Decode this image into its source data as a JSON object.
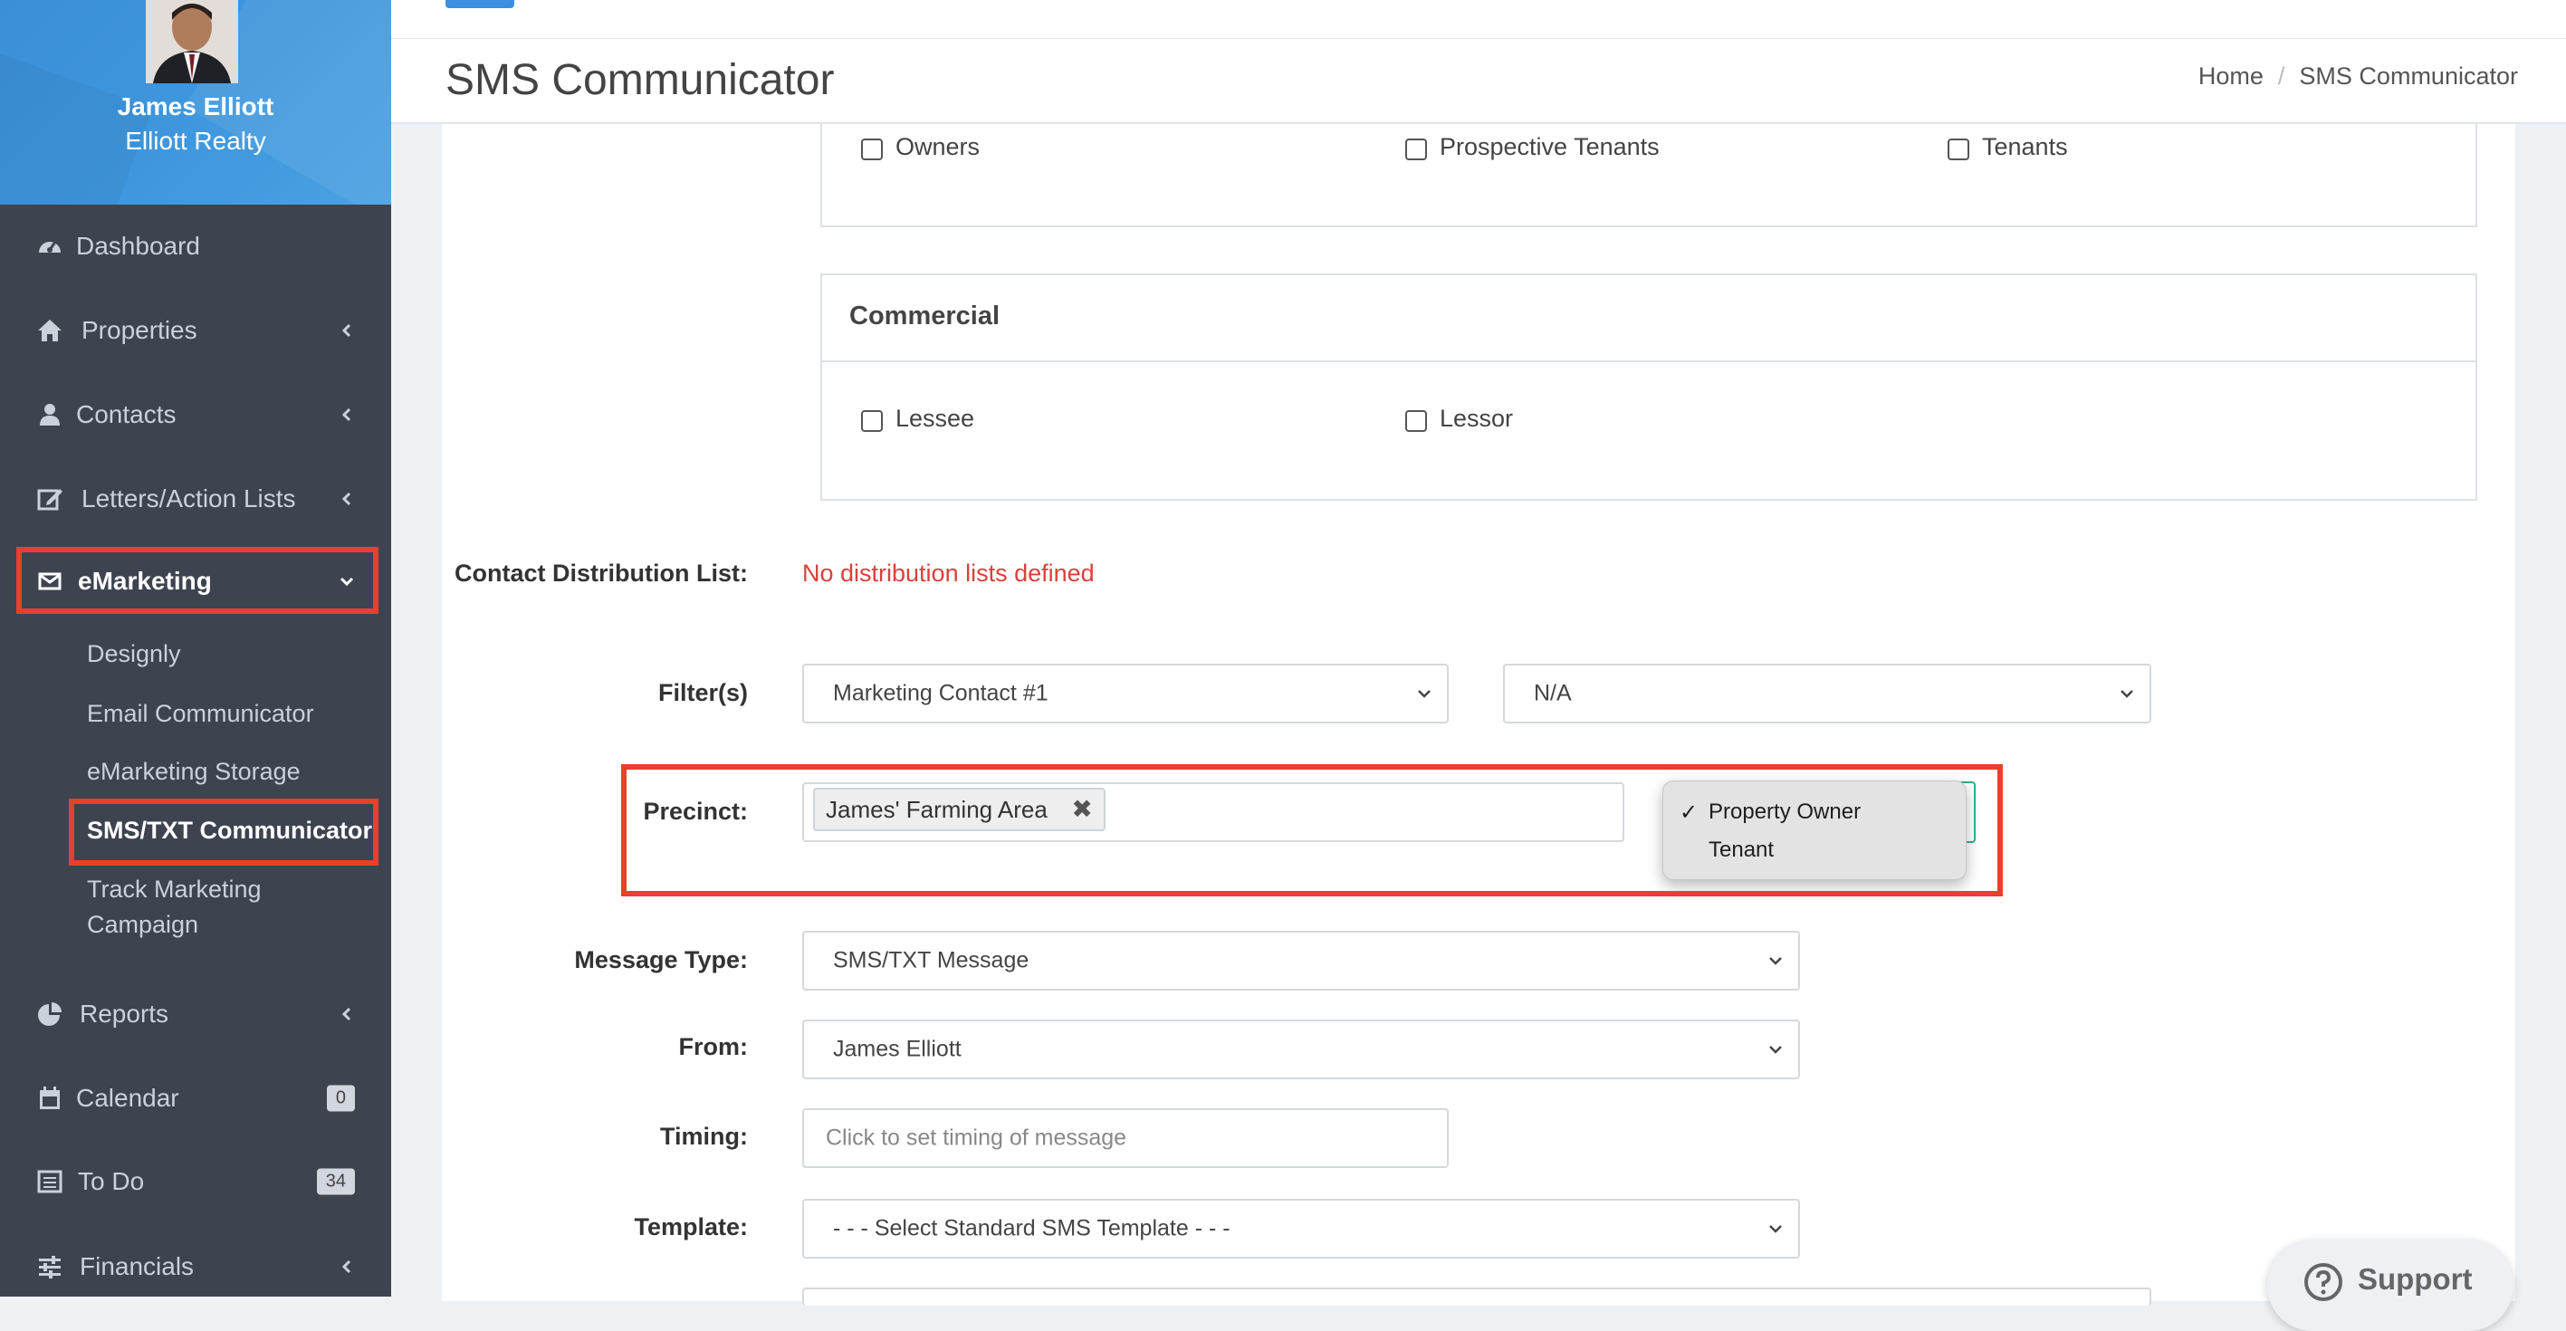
{
  "profile": {
    "name": "James Elliott",
    "company": "Elliott Realty"
  },
  "nav": {
    "dashboard": "Dashboard",
    "properties": "Properties",
    "contacts": "Contacts",
    "letters": "Letters/Action Lists",
    "emarketing": "eMarketing",
    "sub": {
      "designly": "Designly",
      "email": "Email Communicator",
      "storage": "eMarketing Storage",
      "sms": "SMS/TXT Communicator",
      "track_line1": "Track Marketing",
      "track_line2": "Campaign"
    },
    "reports": "Reports",
    "calendar": "Calendar",
    "calendar_badge": "0",
    "todo": "To Do",
    "todo_badge": "34",
    "financials": "Financials"
  },
  "header": {
    "title": "SMS Communicator"
  },
  "breadcrumb": {
    "home": "Home",
    "separator": "/",
    "current": "SMS Communicator"
  },
  "residential": {
    "owners": "Owners",
    "prospective": "Prospective Tenants",
    "tenants": "Tenants"
  },
  "commercial": {
    "heading": "Commercial",
    "lessee": "Lessee",
    "lessor": "Lessor"
  },
  "form": {
    "dist_label": "Contact Distribution List:",
    "dist_value": "No distribution lists defined",
    "filters_label": "Filter(s)",
    "filter1": "Marketing Contact #1",
    "filter2": "N/A",
    "precinct_label": "Precinct:",
    "precinct_tag": "James' Farming Area",
    "precinct_tag_remove": "✖",
    "message_type_label": "Message Type:",
    "message_type": "SMS/TXT Message",
    "from_label": "From:",
    "from": "James Elliott",
    "timing_label": "Timing:",
    "timing_placeholder": "Click to set timing of message",
    "template_label": "Template:",
    "template": "- - - Select Standard SMS Template - - -"
  },
  "dropdown": {
    "selected_mark": "✓",
    "options": [
      "Property Owner",
      "Tenant"
    ]
  },
  "support": {
    "label": "Support"
  },
  "colors": {
    "highlight": "#e8402a",
    "sidebar": "#3d4450",
    "accent": "#3c8fe0",
    "error": "#d9413c"
  }
}
